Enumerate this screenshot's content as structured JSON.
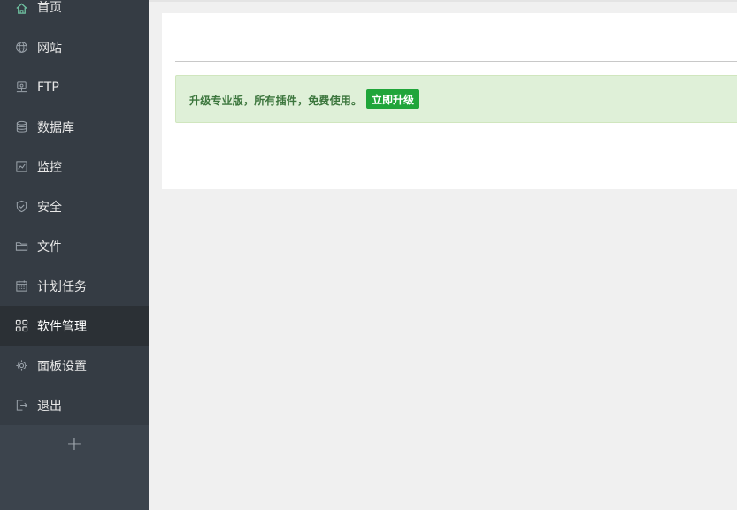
{
  "sidebar": {
    "items": [
      {
        "label": "首页",
        "icon": "home-icon"
      },
      {
        "label": "网站",
        "icon": "globe-icon"
      },
      {
        "label": "FTP",
        "icon": "ftp-icon"
      },
      {
        "label": "数据库",
        "icon": "database-icon"
      },
      {
        "label": "监控",
        "icon": "monitor-icon"
      },
      {
        "label": "安全",
        "icon": "shield-icon"
      },
      {
        "label": "文件",
        "icon": "folder-icon"
      },
      {
        "label": "计划任务",
        "icon": "calendar-icon"
      },
      {
        "label": "软件管理",
        "icon": "grid-icon",
        "active": true
      },
      {
        "label": "面板设置",
        "icon": "gear-icon"
      },
      {
        "label": "退出",
        "icon": "logout-icon"
      }
    ],
    "add_label": "+"
  },
  "main": {
    "alert": {
      "text": "升级专业版，所有插件，免费使用。",
      "button": "立即升级"
    }
  },
  "colors": {
    "sidebar_bg": "#353c44",
    "sidebar_active": "#2b3035",
    "accent_green": "#20a53a",
    "alert_bg": "#dff0d8",
    "alert_text": "#3c763d"
  }
}
